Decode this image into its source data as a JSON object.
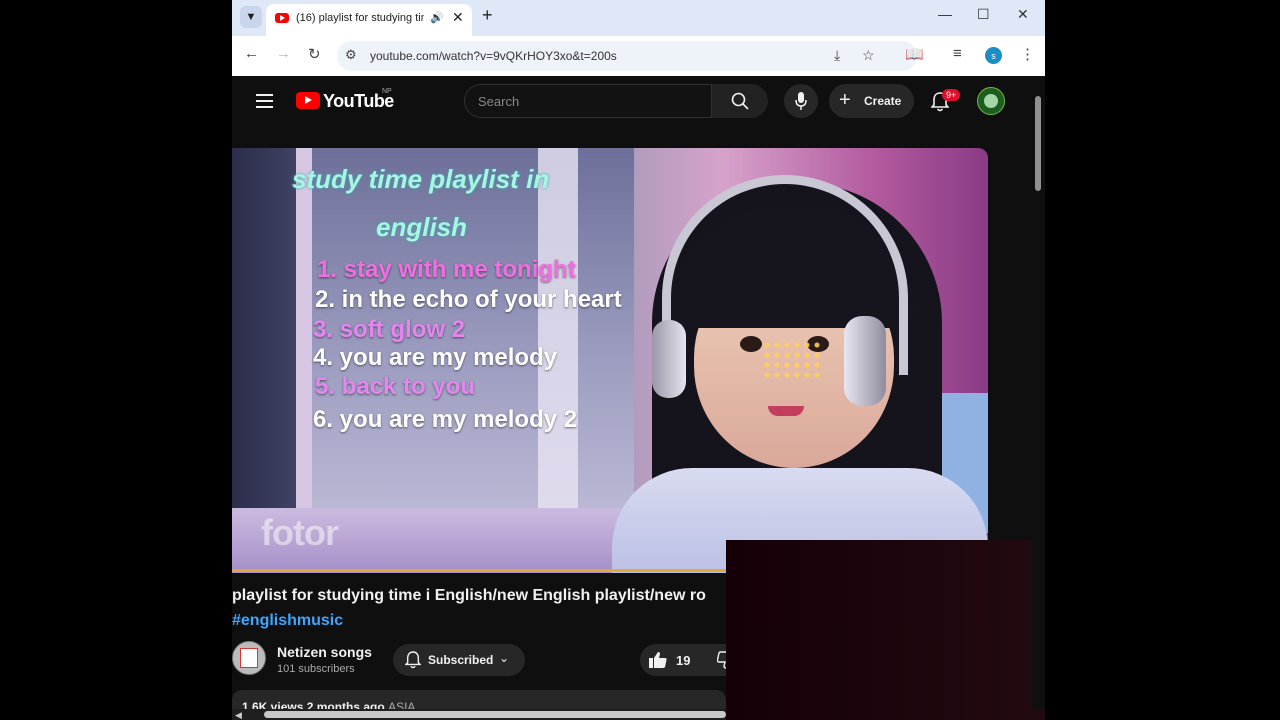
{
  "browser": {
    "tab_title": "(16) playlist for studying tim",
    "new_tab_symbol": "+",
    "close_symbol": "✕",
    "url": "youtube.com/watch?v=9vQKrHOY3xo&t=200s",
    "profile_initial": "s"
  },
  "youtube": {
    "logo_text": "YouTube",
    "country_code": "NP",
    "search_placeholder": "Search",
    "create_label": "Create",
    "notification_count": "9+",
    "colors": {
      "brand": "#ff0000",
      "link": "#3ea6ff",
      "badge": "#e0102d"
    }
  },
  "video_thumbnail": {
    "title_line1": "study time playlist in",
    "title_line2": "english",
    "tracks": [
      "1. stay with me tonight",
      "2. in the echo of your heart",
      "3. soft glow 2",
      "4. you are my melody",
      "5. back to you",
      "6. you are my melody 2"
    ],
    "watermark": "fotor"
  },
  "video": {
    "title": "playlist for studying time i English/new English playlist/new ro",
    "hashtag": "#englishmusic",
    "channel_name": "Netizen songs",
    "subscribers": "101 subscribers",
    "subscribe_label": "Subscribed",
    "likes": "19",
    "meta": "1.6K views  2 months ago",
    "meta_tag": "ASIA"
  }
}
